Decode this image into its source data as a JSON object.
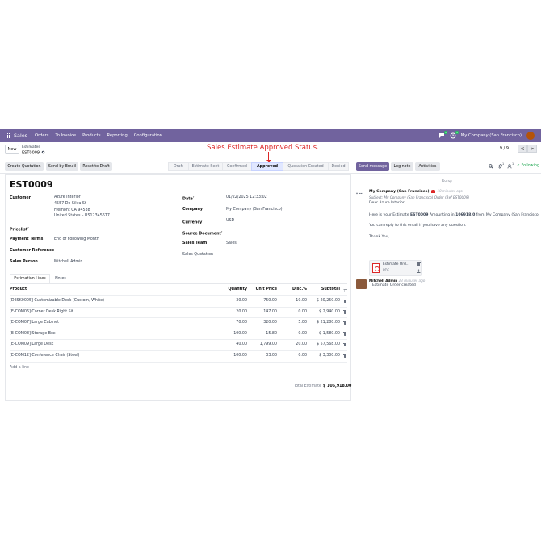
{
  "topbar": {
    "brand": "Sales",
    "menus": [
      "Orders",
      "To Invoice",
      "Products",
      "Reporting",
      "Configuration"
    ],
    "chat_count": "5",
    "activity_count": "3",
    "company": "My Company (San Francisco)"
  },
  "breadcrumb": {
    "new_label": "New",
    "parent": "Estimates",
    "current": "EST0009"
  },
  "annotation": "Sales Estimate Approved Status.",
  "pager": {
    "text": "9 / 9",
    "prev": "<",
    "next": ">"
  },
  "actions": [
    "Create Quotation",
    "Send by Email",
    "Reset to Draft"
  ],
  "statuses": [
    "Draft",
    "Estimate Sent",
    "Confirmed",
    "Approved",
    "Quotation Created",
    "Denied"
  ],
  "active_status": "Approved",
  "chatter_buttons": {
    "send": "Send message",
    "log": "Log note",
    "activities": "Activities"
  },
  "chatter_icons": {
    "attachments": "1",
    "followers": "1",
    "following": "Following"
  },
  "record": {
    "name": "EST0009",
    "customer_label": "Customer",
    "customer_lines": [
      "Azure Interior",
      "4557 De Silva St",
      "Fremont CA 94538",
      "United States – US12345677"
    ],
    "pricelist_label": "Pricelist",
    "payment_terms_label": "Payment Terms",
    "payment_terms": "End of Following Month",
    "customer_ref_label": "Customer Reference",
    "salesperson_label": "Sales Person",
    "salesperson": "Mitchell Admin",
    "date_label": "Date",
    "date": "01/22/2025 12:33:02",
    "company_label": "Company",
    "company": "My Company (San Francisco)",
    "currency_label": "Currency",
    "currency": "USD",
    "source_label": "Source Document",
    "team_label": "Sales Team",
    "team": "Sales",
    "quotation_label": "Sales Quotation"
  },
  "tabs": [
    "Estimation Lines",
    "Notes"
  ],
  "table": {
    "headers": [
      "Product",
      "Quantity",
      "Unit Price",
      "Disc.%",
      "Subtotal"
    ],
    "rows": [
      [
        "[DESK0005] Customizable Desk (Custom, White)",
        "30.00",
        "750.00",
        "10.00",
        "$ 20,250.00"
      ],
      [
        "[E-COM06] Corner Desk Right Sit",
        "20.00",
        "147.00",
        "0.00",
        "$ 2,940.00"
      ],
      [
        "[E-COM07] Large Cabinet",
        "70.00",
        "320.00",
        "5.00",
        "$ 21,280.00"
      ],
      [
        "[E-COM08] Storage Box",
        "100.00",
        "15.80",
        "0.00",
        "$ 1,580.00"
      ],
      [
        "[E-COM09] Large Desk",
        "40.00",
        "1,799.00",
        "20.00",
        "$ 57,568.00"
      ],
      [
        "[E-COM12] Conference Chair (Steel)",
        "100.00",
        "33.00",
        "0.00",
        "$ 3,300.00"
      ]
    ],
    "add_line": "Add a line",
    "total_label": "Total Estimate",
    "total_value": "$ 106,918.00"
  },
  "chatter": {
    "date": "Today",
    "author": "My Company (San Francisco)",
    "time": "18 minutes ago",
    "subject": "Subject: My Company (San Francisco) Order (Ref EST0009)",
    "greeting": "Dear Azure Interior,",
    "body_pre": "Here is your Estimate ",
    "body_ref": "EST0009",
    "body_mid": " Amounting in ",
    "body_amount": "106918.0",
    "body_post": " from My Company (San Francisco)",
    "reply": "You can reply to this email if you have any question.",
    "thanks": "Thank You,",
    "attachment_name": "Estimate Ord...",
    "attachment_type": "PDF",
    "log_author": "Mitchell Admin",
    "log_time": "23 minutes ago",
    "log_text": "Estimate Order created"
  }
}
